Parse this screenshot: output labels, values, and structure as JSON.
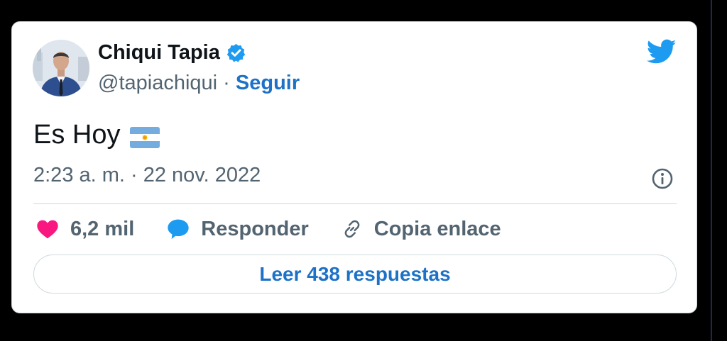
{
  "author": {
    "display_name": "Chiqui Tapia",
    "handle": "@tapiachiqui",
    "separator": " · ",
    "follow_label": "Seguir"
  },
  "tweet": {
    "text": "Es Hoy",
    "timestamp": "2:23 a. m. · 22 nov. 2022"
  },
  "actions": {
    "likes_count": "6,2 mil",
    "reply_label": "Responder",
    "copy_link_label": "Copia enlace"
  },
  "read_replies_label": "Leer 438 respuestas",
  "icons": {
    "verified": "verified-badge-icon",
    "brand": "twitter-bird-icon",
    "flag": "argentina-flag-icon",
    "info": "info-icon",
    "like": "heart-icon",
    "reply": "speech-bubble-icon",
    "link": "link-icon"
  },
  "colors": {
    "brand_blue": "#1d9bf0",
    "link_blue": "#1d72c8",
    "heart": "#f91880",
    "text_primary": "#0f1419",
    "text_secondary": "#536471",
    "border": "#cfd9de"
  }
}
